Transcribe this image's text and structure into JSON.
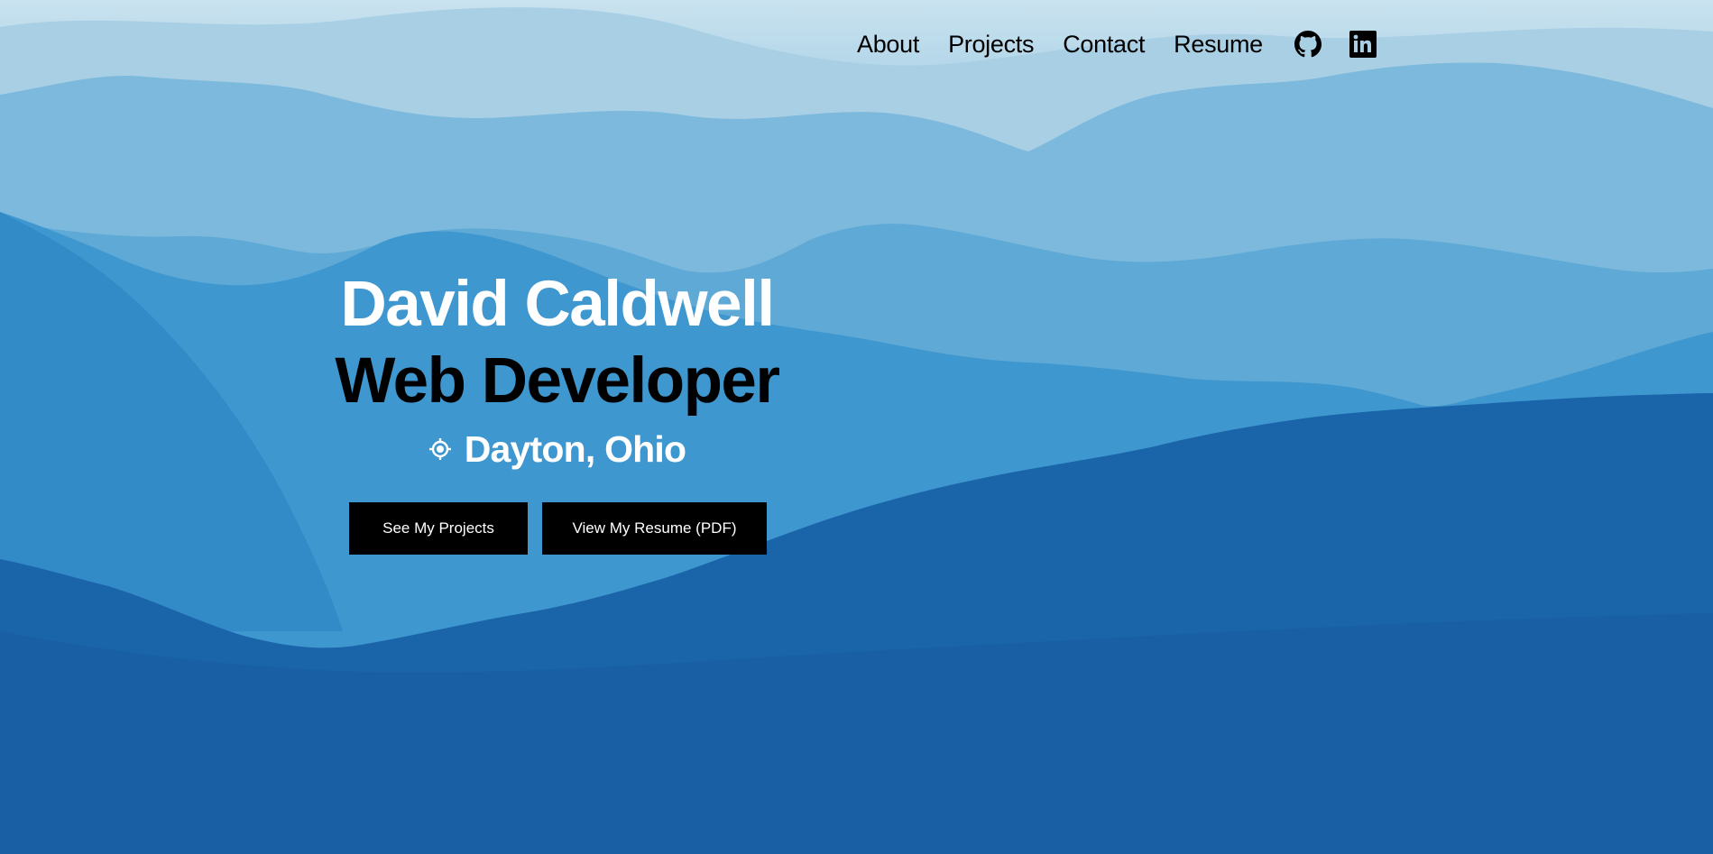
{
  "nav": {
    "items": [
      {
        "label": "About"
      },
      {
        "label": "Projects"
      },
      {
        "label": "Contact"
      },
      {
        "label": "Resume"
      }
    ],
    "icons": [
      "github-icon",
      "linkedin-icon"
    ]
  },
  "hero": {
    "name": "David Caldwell",
    "title": "Web Developer",
    "location": "Dayton, Ohio",
    "location_icon": "crosshair-location-icon"
  },
  "buttons": {
    "projects_label": "See My Projects",
    "resume_label": "View My Resume (PDF)"
  },
  "colors": {
    "button_bg": "#000000",
    "button_text": "#ffffff",
    "name_text": "#ffffff",
    "title_text": "#000000",
    "nav_text": "#000000"
  }
}
